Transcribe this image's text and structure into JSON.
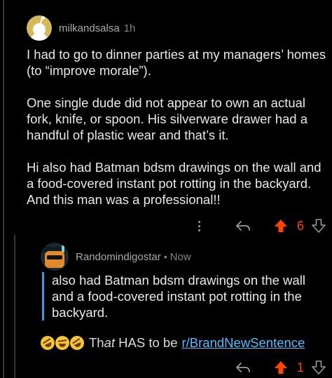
{
  "comment1": {
    "username": "milkandsalsa",
    "time": "1h",
    "paragraphs": [
      "I had to go to dinner parties at my managers’ homes (to “improve morale”).",
      "One single dude did not appear to own an actual fork, knife, or spoon. His silverware drawer had a handful of plastic wear and that’s it.",
      "Hi also had Batman bdsm drawings on the wall and a food-covered instant pot rotting in the backyard. And this man was a professional!!"
    ],
    "score": "6",
    "vote_state": "upvoted"
  },
  "comment2": {
    "username": "Randomindigostar",
    "separator": "•",
    "time": "Now",
    "quote": "also had Batman bdsm drawings on the wall and a food-covered instant pot rotting in the backyard.",
    "text_before": "Th",
    "text_italic": "at",
    "text_after": " HAS to be",
    "subreddit_link": "r/BrandNewSentence",
    "score": "1",
    "vote_state": "upvoted"
  },
  "icons": {
    "more": "more-vertical-icon",
    "reply": "reply-icon",
    "upvote": "upvote-arrow-icon",
    "downvote": "downvote-arrow-icon",
    "emoji": "laughing-crying-emoji"
  },
  "colors": {
    "background": "#000000",
    "upvote": "#ff4500",
    "link": "#4fbcff",
    "quote_bar": "#3a9bdc"
  }
}
